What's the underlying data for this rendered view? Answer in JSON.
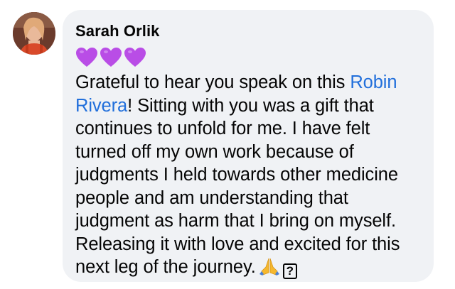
{
  "comment": {
    "avatar": {
      "icon": "profile-photo",
      "accent": "#d94a2a"
    },
    "author_name": "Sarah Orlik",
    "reaction_emoji": [
      "purple-heart",
      "purple-heart",
      "purple-heart"
    ],
    "text_before_mention": "Grateful to hear you speak on this",
    "mention": "Robin Rivera",
    "text_after_mention": "! Sitting with you was a gift that continues to unfold for me. I have felt turned off my own work because of judgments I held towards other medicine people and am understanding that judgment as harm that I bring on myself. Releasing it with love and excited for this next leg of the journey.",
    "trailing_icons": [
      "folded-hands-emoji",
      "unknown-glyph"
    ],
    "unknown_glyph_text": "?",
    "colors": {
      "bubble": "#f0f2f5",
      "text": "#050505",
      "mention": "#216fdb",
      "heart": "#b94de6"
    }
  }
}
